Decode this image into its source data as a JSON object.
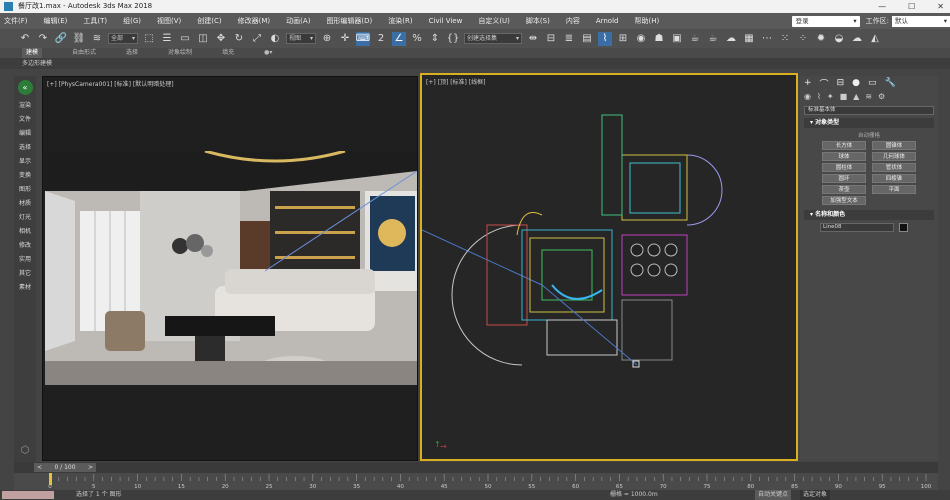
{
  "window": {
    "title": "餐厅改1.max - Autodesk 3ds Max 2018",
    "min": "—",
    "max": "☐",
    "close": "✕"
  },
  "menu": [
    "文件(F)",
    "编辑(E)",
    "工具(T)",
    "组(G)",
    "视图(V)",
    "创建(C)",
    "修改器(M)",
    "动画(A)",
    "图形编辑器(D)",
    "渲染(R)",
    "Civil View",
    "自定义(U)",
    "脚本(S)",
    "内容",
    "Arnold",
    "帮助(H)"
  ],
  "login": "登录",
  "workspace": {
    "label": "工作区:",
    "value": "默认"
  },
  "toolbar": {
    "selection_filter": "全部",
    "coord": "视图",
    "named_selection": "创建选择集"
  },
  "ribbon": {
    "tabs": [
      "建模",
      "自由形式",
      "选择",
      "对象绘制",
      "填充"
    ],
    "sub": "多边形建模"
  },
  "left_panel": [
    "渲染",
    "文件",
    "编辑",
    "选择",
    "显示",
    "变换",
    "图形",
    "材质",
    "灯光",
    "相机",
    "修改",
    "实用",
    "其它",
    "素材"
  ],
  "viewports": {
    "left": {
      "label": "[+] [PhysCamera001] [标准] [默认明暗处理]"
    },
    "right": {
      "label": "[+] [顶] [标准] [线框]"
    }
  },
  "command_panel": {
    "category": "标准基本体",
    "object_type_title": "对象类型",
    "autogrid": "自动栅格",
    "buttons": [
      "长方体",
      "圆锥体",
      "球体",
      "几何球体",
      "圆柱体",
      "管状体",
      "圆环",
      "四棱锥",
      "茶壶",
      "平面",
      "加强型文本"
    ],
    "name_color_title": "名称和颜色",
    "name_value": "Line08",
    "object_color": "#111111"
  },
  "time_slider": "0 / 100",
  "timeline": {
    "ticks": [
      "0",
      "5",
      "10",
      "15",
      "20",
      "25",
      "30",
      "35",
      "40",
      "45",
      "50",
      "55",
      "60",
      "65",
      "70",
      "75",
      "80",
      "85",
      "90",
      "95",
      "100"
    ]
  },
  "status": {
    "selected": "选择了 1 个 图形",
    "grid": "栅格 = 1000.0m",
    "auto_key": "自动关键点",
    "set_key": "选定对象"
  },
  "colors": {
    "accent": "#3a6ea5",
    "active_viewport_border": "#d8b020",
    "logo": "#2d7d3a"
  }
}
